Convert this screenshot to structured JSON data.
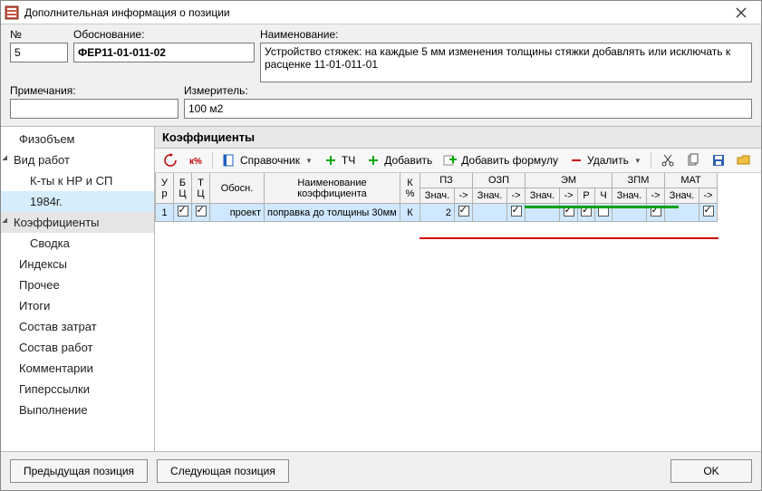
{
  "window": {
    "title": "Дополнительная информация о позиции"
  },
  "labels": {
    "number": "№",
    "obosnovanie": "Обоснование:",
    "naimenovanie": "Наименование:",
    "primechaniya": "Примечания:",
    "izmeritel": "Измеритель:"
  },
  "fields": {
    "number": "5",
    "obosnovanie": "ФЕР11-01-011-02",
    "naimenovanie": "Устройство стяжек: на каждые 5 мм изменения толщины стяжки добавлять или исключать к расценке 11-01-011-01",
    "primechaniya": "",
    "izmeritel": "100 м2"
  },
  "sidebar": {
    "items": [
      {
        "label": "Физобъем",
        "type": "item"
      },
      {
        "label": "Вид работ",
        "type": "parent"
      },
      {
        "label": "К-ты к НР и СП",
        "type": "child"
      },
      {
        "label": "1984г.",
        "type": "child",
        "selected": true
      },
      {
        "label": "Коэффициенты",
        "type": "parent",
        "active": true
      },
      {
        "label": "Сводка",
        "type": "child"
      },
      {
        "label": "Индексы",
        "type": "item"
      },
      {
        "label": "Прочее",
        "type": "item"
      },
      {
        "label": "Итоги",
        "type": "item"
      },
      {
        "label": "Состав затрат",
        "type": "item"
      },
      {
        "label": "Состав работ",
        "type": "item"
      },
      {
        "label": "Комментарии",
        "type": "item"
      },
      {
        "label": "Гиперссылки",
        "type": "item"
      },
      {
        "label": "Выполнение",
        "type": "item"
      }
    ]
  },
  "main": {
    "title": "Коэффициенты",
    "toolbar": {
      "spravochnik": "Справочник",
      "tch": "ТЧ",
      "dobavit": "Добавить",
      "dobavit_formulu": "Добавить формулу",
      "udalit": "Удалить"
    },
    "columns": {
      "ur": "У р",
      "bc": "Б Ц",
      "tc": "Т Ц",
      "obosn": "Обосн.",
      "naim": "Наименование коэффициента",
      "kpct": "К %",
      "pz": "ПЗ",
      "ozp": "ОЗП",
      "em": "ЭМ",
      "zpm": "ЗПМ",
      "mat": "МАТ",
      "znach": "Знач.",
      "arrow": "->",
      "r": "Р",
      "ch": "Ч"
    },
    "rows": [
      {
        "ur": "1",
        "bc": true,
        "tc": true,
        "obosn": "проект",
        "naim": "поправка до толщины 30мм",
        "kpct": "К",
        "pz_znach": "2",
        "pz_chk": true,
        "ozp_chk": true,
        "em_chk": true,
        "em_r": true,
        "em_ch": false,
        "zpm_chk": true,
        "mat_chk": true
      }
    ]
  },
  "footer": {
    "prev": "Предыдущая позиция",
    "next": "Следующая позиция",
    "ok": "OK"
  }
}
